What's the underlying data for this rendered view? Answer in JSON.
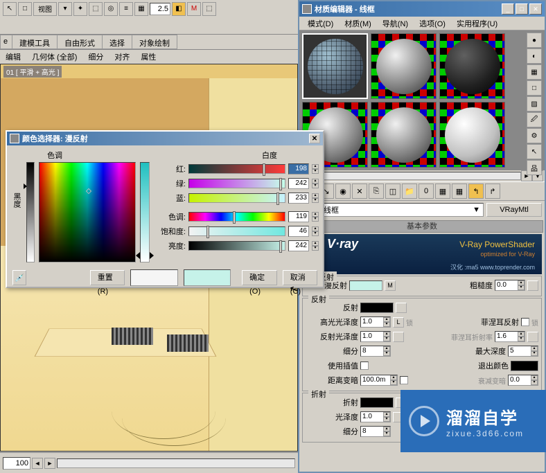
{
  "main": {
    "toolbar": {
      "view_btn": "视图",
      "zoom": "2.5"
    },
    "tabs": [
      "建模工具",
      "自由形式",
      "选择",
      "对象绘制"
    ],
    "tabs_prefix": "e",
    "subtabs": [
      "编辑",
      "几何体 (全部)",
      "细分",
      "对齐",
      "属性"
    ],
    "viewport_label": "01 [ 平滑 + 高光 ]",
    "bottom_value": "100"
  },
  "mat_editor": {
    "title": "材质编辑器 - 线框",
    "menus": [
      "模式(D)",
      "材质(M)",
      "导航(N)",
      "选项(O)",
      "实用程序(U)"
    ],
    "name": "线框",
    "type_btn": "VRayMtl",
    "rollup_basic": "基本参数",
    "vray": {
      "logo": "V·ray",
      "powershader": "V-Ray PowerShader",
      "optimized": "optimized for V-Ray",
      "footer": "汉化 :ma5 www.toprender.com"
    },
    "groups": {
      "diffuse": {
        "title": "漫反射",
        "label": "漫反射",
        "rough_label": "粗糙度",
        "rough_val": "0.0",
        "m_btn": "M"
      },
      "reflect": {
        "title": "反射",
        "reflect_label": "反射",
        "lock_label": "锁",
        "fresnel_label": "菲涅耳反射",
        "hilight_label": "高光光泽度",
        "hilight_val": "1.0",
        "fres_ior_label": "菲涅耳折射率",
        "fres_ior_val": "1.6",
        "refl_gloss_label": "反射光泽度",
        "refl_gloss_val": "1.0",
        "maxdepth_label": "最大深度",
        "maxdepth_val": "5",
        "subdiv_label": "细分",
        "subdiv_val": "8",
        "exitcolor_label": "退出颜色",
        "interp_label": "使用插值",
        "dimdist_label": "距离变暗",
        "dimdist_val": "100.0m",
        "dimfall_label": "衰减变暗",
        "dimfall_val": "0.0"
      },
      "refract": {
        "title": "折射",
        "refract_label": "折射",
        "gloss_label": "光泽度",
        "gloss_val": "1.0",
        "subdiv_label": "细分",
        "subdiv_val": "8"
      }
    }
  },
  "color_picker": {
    "title": "颜色选择器: 漫反射",
    "hue_label": "色调",
    "whiteness_label": "白度",
    "black_label": "黑度",
    "channels": {
      "red": {
        "label": "红:",
        "val": "198"
      },
      "green": {
        "label": "绿:",
        "val": "242"
      },
      "blue": {
        "label": "蓝:",
        "val": "233"
      },
      "hue": {
        "label": "色调:",
        "val": "119"
      },
      "sat": {
        "label": "饱和度:",
        "val": "46"
      },
      "value": {
        "label": "亮度:",
        "val": "242"
      }
    },
    "swatch_color": "#c6f2e9",
    "reset_btn": "重置(R)",
    "ok_btn": "确定(O)",
    "cancel_btn": "取消(C)"
  },
  "watermark": {
    "main": "溜溜自学",
    "sub": "zixue.3d66.com"
  }
}
